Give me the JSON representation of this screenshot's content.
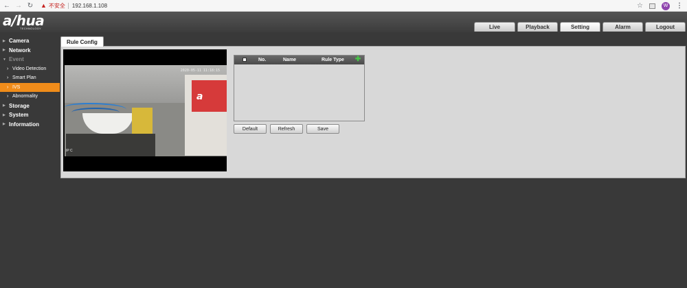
{
  "browser": {
    "insecure_label": "不安全",
    "url": "192.168.1.108",
    "profile_initial": "W",
    "icons": {
      "back": "arrow-left-icon",
      "forward": "arrow-right-icon",
      "reload": "reload-icon",
      "warning": "warning-icon",
      "bookmark": "star-icon",
      "extension": "extension-icon",
      "menu": "more-vert-icon"
    }
  },
  "brand": {
    "logo": "a/hua",
    "sub": "TECHNOLOGY"
  },
  "top_nav": {
    "tabs": [
      {
        "label": "Live",
        "active": false
      },
      {
        "label": "Playback",
        "active": false
      },
      {
        "label": "Setting",
        "active": true
      },
      {
        "label": "Alarm",
        "active": false
      },
      {
        "label": "Logout",
        "active": false
      }
    ]
  },
  "sidebar": {
    "items": [
      {
        "label": "Camera"
      },
      {
        "label": "Network"
      },
      {
        "label": "Event"
      },
      {
        "label": "Video Detection"
      },
      {
        "label": "Smart Plan"
      },
      {
        "label": "IVS"
      },
      {
        "label": "Abnormality"
      },
      {
        "label": "Storage"
      },
      {
        "label": "System"
      },
      {
        "label": "Information"
      }
    ],
    "active_item": "IVS"
  },
  "content": {
    "tab_label": "Rule Config",
    "video": {
      "osd_time": "2020-05-11 11:18:15",
      "osd_channel": "IP C"
    },
    "rule_table": {
      "headers": {
        "no": "No.",
        "name": "Name",
        "type": "Rule Type"
      },
      "rows": []
    },
    "buttons": {
      "default": "Default",
      "refresh": "Refresh",
      "save": "Save"
    }
  },
  "colors": {
    "accent": "#f08c1a",
    "background": "#393939",
    "panel": "#d8d8d8",
    "add_green": "#47c447"
  }
}
